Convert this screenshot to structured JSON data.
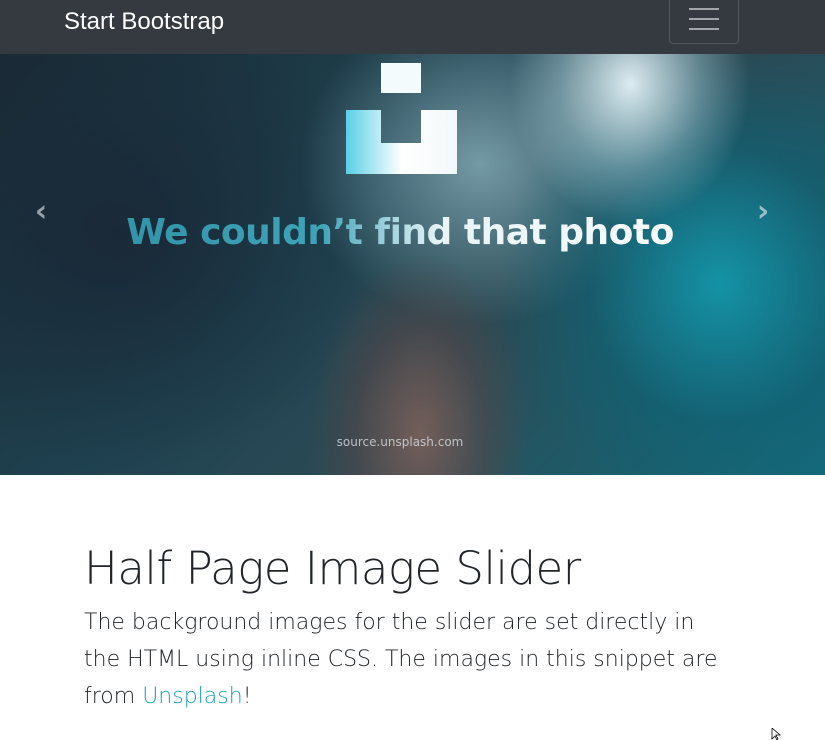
{
  "navbar": {
    "brand": "Start Bootstrap",
    "toggle_icon": "hamburger-menu-icon"
  },
  "carousel": {
    "slide_text": "We couldn’t find that photo",
    "slide_source": "source.unsplash.com",
    "prev_icon": "chevron-left-icon",
    "next_icon": "chevron-right-icon",
    "prev_glyph": "‹",
    "next_glyph": "›"
  },
  "content": {
    "heading": "Half Page Image Slider",
    "lead_text": "The background images for the slider are set directly in the HTML using inline CSS. The images in this snippet are from ",
    "link_text": "Unsplash",
    "lead_end": "!"
  },
  "colors": {
    "navbar_bg": "#343a40",
    "link": "#17a2b8",
    "text": "#212529"
  }
}
